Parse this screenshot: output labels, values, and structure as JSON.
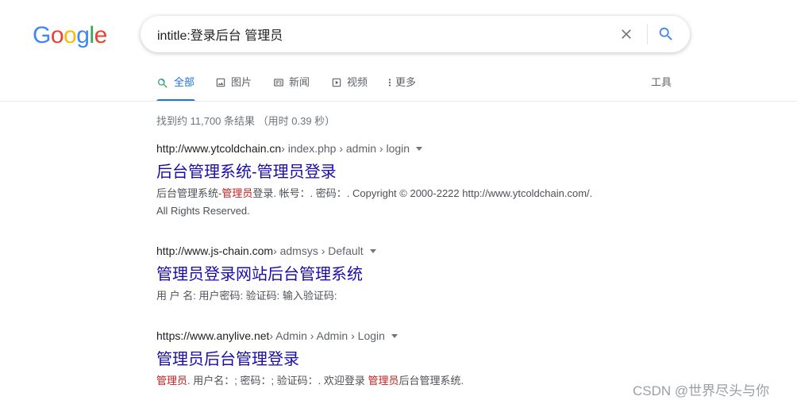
{
  "logo": {
    "letters": [
      "G",
      "o",
      "o",
      "g",
      "l",
      "e"
    ],
    "colors": [
      "#4285f4",
      "#ea4335",
      "#fbbc05",
      "#4285f4",
      "#34a853",
      "#ea4335"
    ]
  },
  "search": {
    "value": "intitle:登录后台 管理员",
    "clear_icon": "close-icon",
    "submit_icon": "search-icon"
  },
  "tabs": [
    {
      "label": "全部",
      "icon": "search-icon",
      "active": true
    },
    {
      "label": "图片",
      "icon": "image-icon",
      "active": false
    },
    {
      "label": "新闻",
      "icon": "news-icon",
      "active": false
    },
    {
      "label": "视频",
      "icon": "video-icon",
      "active": false
    },
    {
      "label": "更多",
      "icon": "more-vert-icon",
      "active": false
    }
  ],
  "tools_label": "工具",
  "stats": "找到约 11,700 条结果 （用时 0.39 秒）",
  "results": [
    {
      "domain": "http://www.ytcoldchain.cn",
      "path": " › index.php › admin › login",
      "title": "后台管理系统-管理员登录",
      "snippet_parts": [
        "后台管理系统-",
        "管理员",
        "登录. 帐号：. 密码：. Copyright © 2000-2222 http://www.ytcoldchain.com/."
      ],
      "snippet_line2": "All Rights Reserved."
    },
    {
      "domain": "http://www.js-chain.com",
      "path": " › admsys › Default",
      "title": "管理员登录网站后台管理系统",
      "snippet": "用 户 名: 用户密码: 验证码: 输入验证码:"
    },
    {
      "domain": "https://www.anylive.net",
      "path": " › Admin › Admin › Login",
      "title": "管理员后台管理登录",
      "snippet_parts": [
        "管理员",
        ". 用户名：; 密码：; 验证码：. 欢迎登录 ",
        "管理员",
        "后台管理系统."
      ]
    }
  ],
  "watermark": "CSDN @世界尽头与你",
  "colors": {
    "link": "#1a0dab",
    "accent": "#1a73e8",
    "highlight": "#c5221f"
  }
}
